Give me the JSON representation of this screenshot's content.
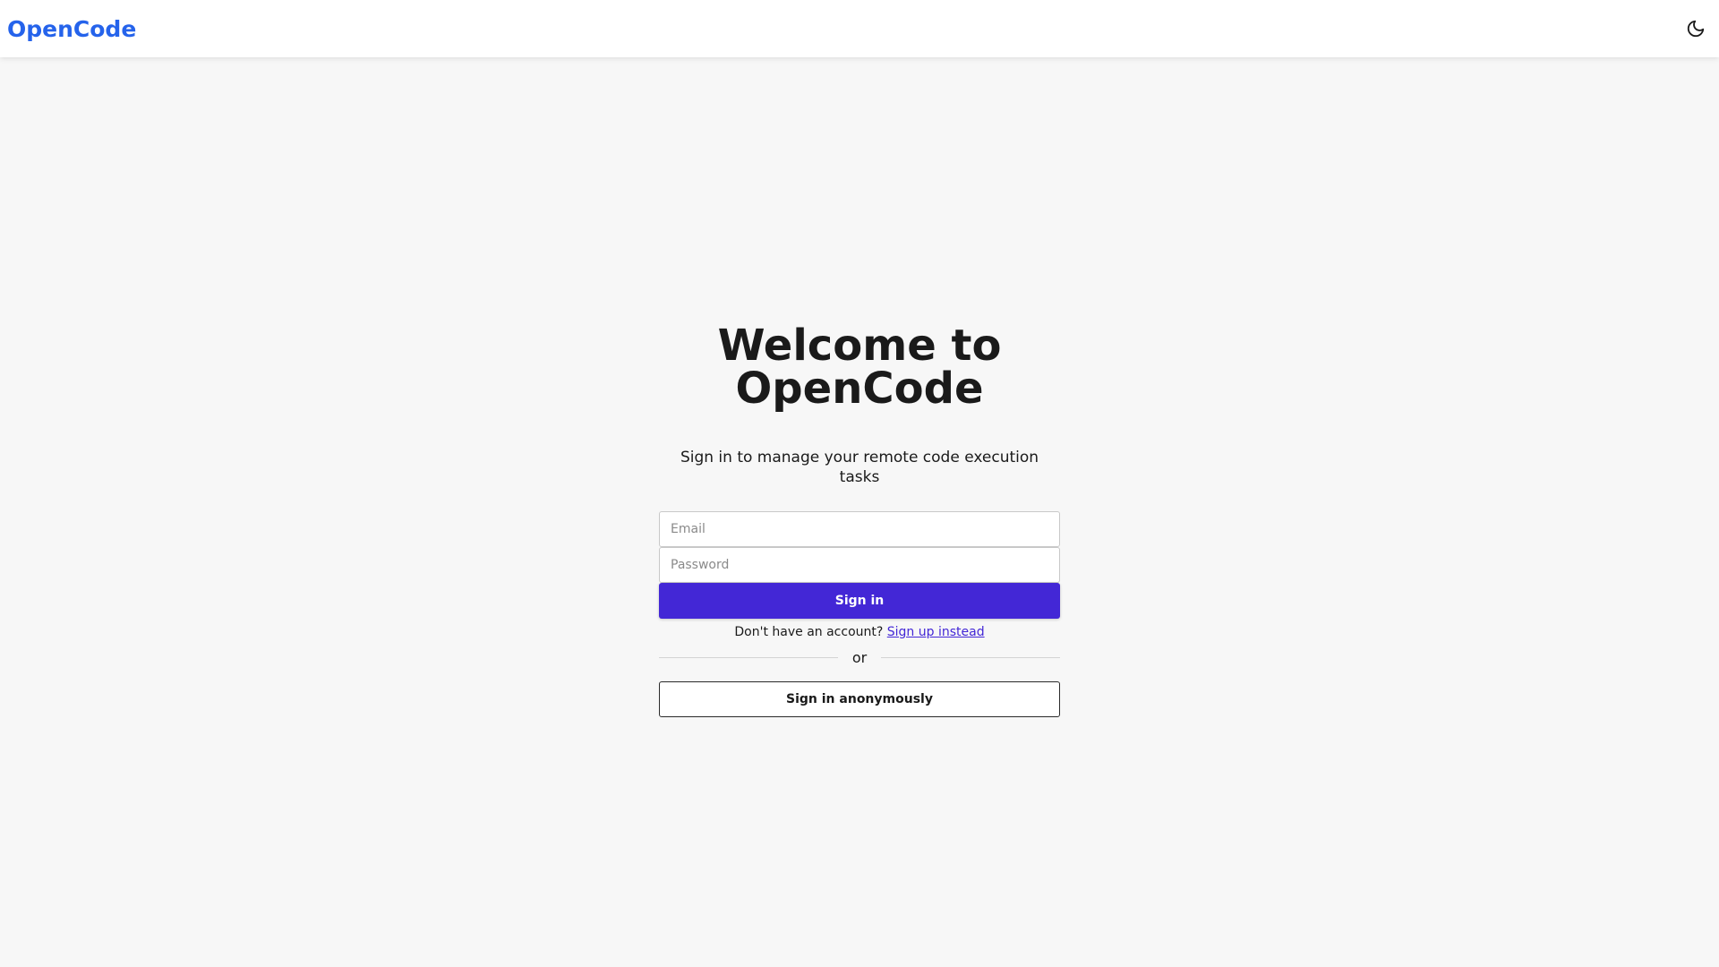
{
  "header": {
    "brand": "OpenCode",
    "theme_toggle_icon": "moon-icon"
  },
  "main": {
    "title_line1": "Welcome to",
    "title_line2": "OpenCode",
    "subtitle": "Sign in to manage your remote code execution tasks",
    "email_placeholder": "Email",
    "email_value": "",
    "password_placeholder": "Password",
    "password_value": "",
    "sign_in_label": "Sign in",
    "no_account_text": "Don't have an account?",
    "sign_up_link": "Sign up instead",
    "divider_text": "or",
    "anonymous_label": "Sign in anonymously"
  },
  "colors": {
    "brand": "#2563eb",
    "primary_button": "#4327d6",
    "background": "#f7f7f7"
  }
}
